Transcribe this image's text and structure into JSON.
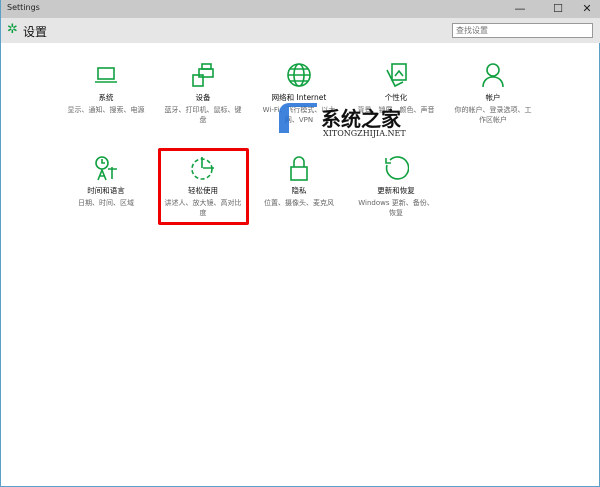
{
  "window": {
    "title": "Settings",
    "minimize": "—",
    "maximize": "☐",
    "close": "✕"
  },
  "header": {
    "title": "设置",
    "search_placeholder": "查找设置"
  },
  "tiles": [
    {
      "title": "系统",
      "desc": "显示、通知、搜索、电源"
    },
    {
      "title": "设备",
      "desc": "蓝牙、打印机、鼠标、键盘"
    },
    {
      "title": "网络和 Internet",
      "desc": "Wi-Fi、飞行模式、以太网、VPN"
    },
    {
      "title": "个性化",
      "desc": "背景、锁屏、颜色、声音"
    },
    {
      "title": "帐户",
      "desc": "你的帐户、登录选项、工作区帐户"
    },
    {
      "title": "时间和语言",
      "desc": "日期、时间、区域"
    },
    {
      "title": "轻松使用",
      "desc": "讲述人、放大镜、高对比度"
    },
    {
      "title": "隐私",
      "desc": "位置、摄像头、麦克风"
    },
    {
      "title": "更新和恢复",
      "desc": "Windows 更新、备份、恢复"
    }
  ],
  "watermark": {
    "name": "系统之家",
    "url": "XITONGZHIJIA.NET"
  },
  "colors": {
    "accent": "#10a040",
    "highlight": "#e00000"
  }
}
